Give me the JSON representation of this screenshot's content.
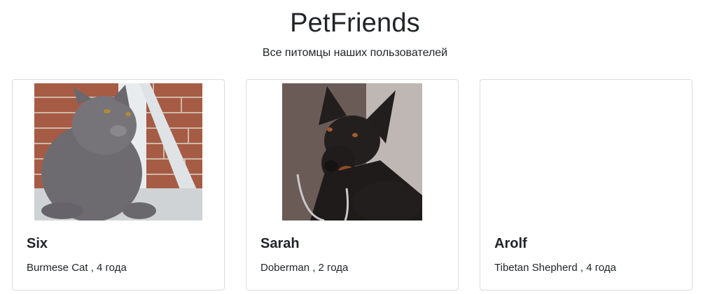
{
  "header": {
    "title": "PetFriends",
    "subtitle": "Все питомцы наших пользователей"
  },
  "pets": [
    {
      "name": "Six",
      "info": "Burmese Cat , 4 года",
      "photo_icon": "cat-photo"
    },
    {
      "name": "Sarah",
      "info": "Doberman , 2 года",
      "photo_icon": "doberman-photo"
    },
    {
      "name": "Arolf",
      "info": "Tibetan Shepherd , 4 года",
      "photo_icon": ""
    }
  ]
}
